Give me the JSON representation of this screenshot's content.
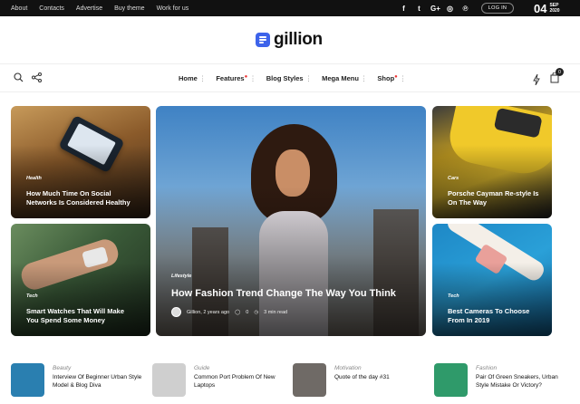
{
  "topbar": {
    "links": [
      "About",
      "Contacts",
      "Advertise",
      "Buy theme",
      "Work for us"
    ],
    "social_icons": [
      "facebook-icon",
      "twitter-icon",
      "google-plus-icon",
      "instagram-icon",
      "pinterest-icon"
    ],
    "social_glyphs": [
      "f",
      "t",
      "G+",
      "◎",
      "℗"
    ],
    "login": "LOG IN",
    "date_day": "04",
    "date_month": "SEP",
    "date_year": "2020"
  },
  "logo": {
    "name": "gillion",
    "color": "#3d63ea"
  },
  "nav": {
    "left_icons": [
      "search-icon",
      "share-icon"
    ],
    "menu": [
      {
        "label": "Home",
        "hot": false
      },
      {
        "label": "Features",
        "hot": true
      },
      {
        "label": "Blog Styles",
        "hot": false
      },
      {
        "label": "Mega Menu",
        "hot": false
      },
      {
        "label": "Shop",
        "hot": true
      }
    ],
    "right_icons": [
      "lightning-icon",
      "cart-icon"
    ],
    "cart_count": "0"
  },
  "featured": [
    {
      "category": "Health",
      "title_lines": [
        "How Much Time On Social",
        "Networks Is Considered Healthy"
      ]
    },
    {
      "category": "Tech",
      "title_lines": [
        "Smart Watches That Will Make",
        "You Spend Some Money"
      ]
    },
    {
      "category": "Lifestyle",
      "title_lines": [
        "How Fashion Trend Change The Way You Think"
      ],
      "author": "Gillion, 2 years ago",
      "comments": "0",
      "read_time": "3 min read"
    },
    {
      "category": "Cars",
      "title_lines": [
        "Porsche Cayman Re-style Is",
        "On The Way"
      ]
    },
    {
      "category": "Tech",
      "title_lines": [
        "Best Cameras To Choose",
        "From In 2019"
      ]
    }
  ],
  "posts": [
    {
      "category": "Beauty",
      "title": "Interview Of Beginner Urban Style Model & Blog Diva",
      "color": "#2a7fb0"
    },
    {
      "category": "Guide",
      "title": "Common Port Problem Of New Laptops",
      "color": "#cfcfcf"
    },
    {
      "category": "Motivation",
      "title": "Quote of the day #31",
      "color": "#6f6a66"
    },
    {
      "category": "Fashion",
      "title": "Pair Of Green Sneakers, Urban Style Mistake Or Victory?",
      "color": "#2f9a6a"
    }
  ]
}
